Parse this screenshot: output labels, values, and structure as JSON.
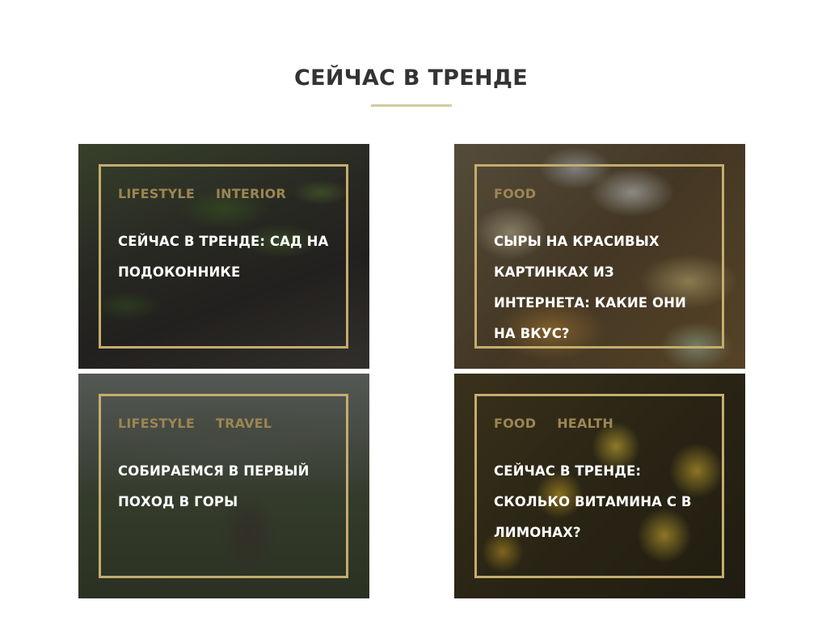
{
  "section": {
    "title": "СЕЙЧАС В ТРЕНДЕ"
  },
  "cards": [
    {
      "tags": [
        "LIFESTYLE",
        "INTERIOR"
      ],
      "title": "СЕЙЧАС В ТРЕНДЕ: САД НА ПОДОКОННИКЕ"
    },
    {
      "tags": [
        "FOOD"
      ],
      "title": "СЫРЫ НА КРАСИВЫХ КАРТИНКАХ ИЗ ИНТЕРНЕТА: КАКИЕ ОНИ НА ВКУС?"
    },
    {
      "tags": [
        "LIFESTYLE",
        "TRAVEL"
      ],
      "title": "СОБИРАЕМСЯ В ПЕРВЫЙ ПОХОД В ГОРЫ"
    },
    {
      "tags": [
        "FOOD",
        "HEALTH"
      ],
      "title": "СЕЙЧАС В ТРЕНДЕ: СКОЛЬКО ВИТАМИНА С В ЛИМОНАХ?"
    }
  ],
  "colors": {
    "accent": "#c4ad6e",
    "tag": "#9c8653",
    "underline": "#d4ca9f",
    "heading": "#333333"
  }
}
